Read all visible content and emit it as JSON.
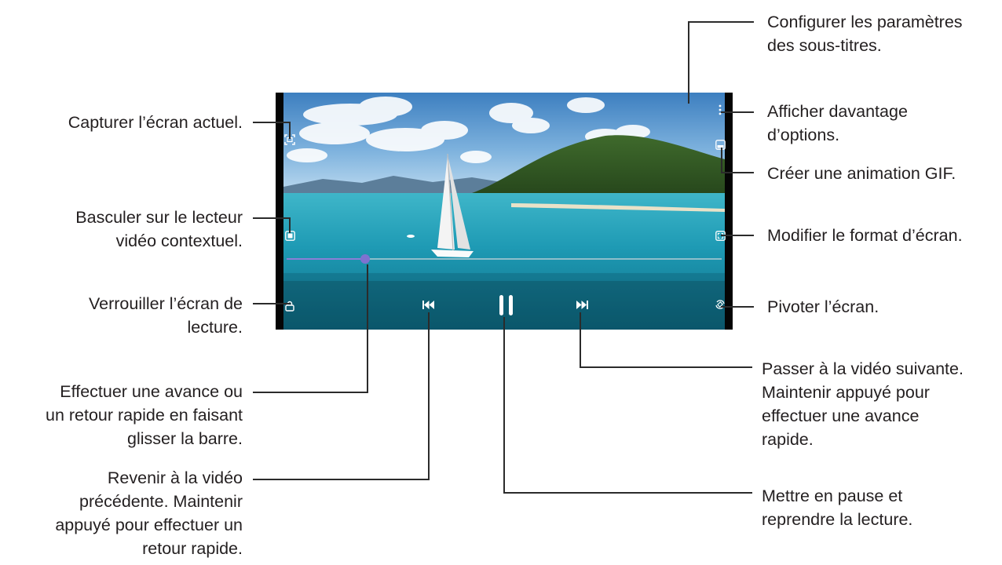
{
  "callouts": {
    "subtitles": [
      "Configurer les paramètres",
      "des sous-titres."
    ],
    "more_options": [
      "Afficher davantage",
      "d’options."
    ],
    "gif": [
      "Créer une animation GIF."
    ],
    "ratio": [
      "Modifier le format d’écran."
    ],
    "rotate": [
      "Pivoter l’écran."
    ],
    "next": [
      "Passer à la vidéo suivante.",
      "Maintenir appuyé pour",
      "effectuer une avance",
      "rapide."
    ],
    "pause": [
      "Mettre en pause et",
      "reprendre la lecture."
    ],
    "capture": [
      "Capturer l’écran actuel."
    ],
    "popup": [
      "Basculer sur le lecteur",
      "vidéo contextuel."
    ],
    "lock": [
      "Verrouiller l’écran de",
      "lecture."
    ],
    "seek": [
      "Effectuer une avance ou",
      "un retour rapide en faisant",
      "glisser la barre."
    ],
    "previous": [
      "Revenir à la vidéo",
      "précédente. Maintenir",
      "appuyé pour effectuer un",
      "retour rapide."
    ]
  },
  "player": {
    "progress": 0.18,
    "icons": {
      "capture": "capture-icon",
      "popup": "popup-player-icon",
      "lock": "lock-icon",
      "more": "more-options-icon",
      "gif": "gif-icon",
      "ratio": "screen-ratio-icon",
      "rotate": "rotate-icon",
      "previous": "previous-icon",
      "pause": "pause-icon",
      "next": "next-icon"
    }
  }
}
